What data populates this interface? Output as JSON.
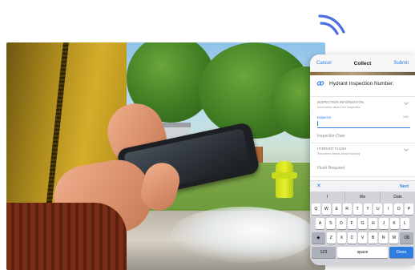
{
  "navbar": {
    "cancel_label": "Cancel",
    "title": "Collect",
    "submit_label": "Submit"
  },
  "form": {
    "title": "Hydrant Inspection Number:"
  },
  "sections": {
    "inspection_info": {
      "title": "INSPECTION INFORMATION",
      "subtitle": "Information about the inspection"
    },
    "inspector": {
      "label": "Inspector",
      "count": "0/50"
    },
    "inspection_date": {
      "label": "Inspection Date"
    },
    "hydrant_flush": {
      "title": "HYDRANT FLUSH",
      "subtitle": "Recorded details about flushing"
    },
    "flush_required": {
      "label": "Flush Required"
    }
  },
  "toolbar": {
    "close_symbol": "✕",
    "next_label": "Next"
  },
  "keyboard": {
    "predictions": [
      "I",
      "We",
      "Date"
    ],
    "row1": [
      "Q",
      "W",
      "E",
      "R",
      "T",
      "Y",
      "U",
      "I",
      "O",
      "P"
    ],
    "row2": [
      "A",
      "S",
      "D",
      "F",
      "G",
      "H",
      "J",
      "K",
      "L"
    ],
    "row3_shift": "◆",
    "row3": [
      "Z",
      "X",
      "C",
      "V",
      "B",
      "N",
      "M"
    ],
    "row3_delete": "⌫",
    "numbers_label": "123",
    "space_label": "space",
    "done_label": "Done"
  },
  "colors": {
    "accent": "#2f7de1",
    "signal": "#4b6ee0"
  },
  "icons": {
    "signal": "wifi-signal-icon",
    "link": "link-icon",
    "chevron": "chevron-down-icon",
    "close": "close-icon"
  }
}
